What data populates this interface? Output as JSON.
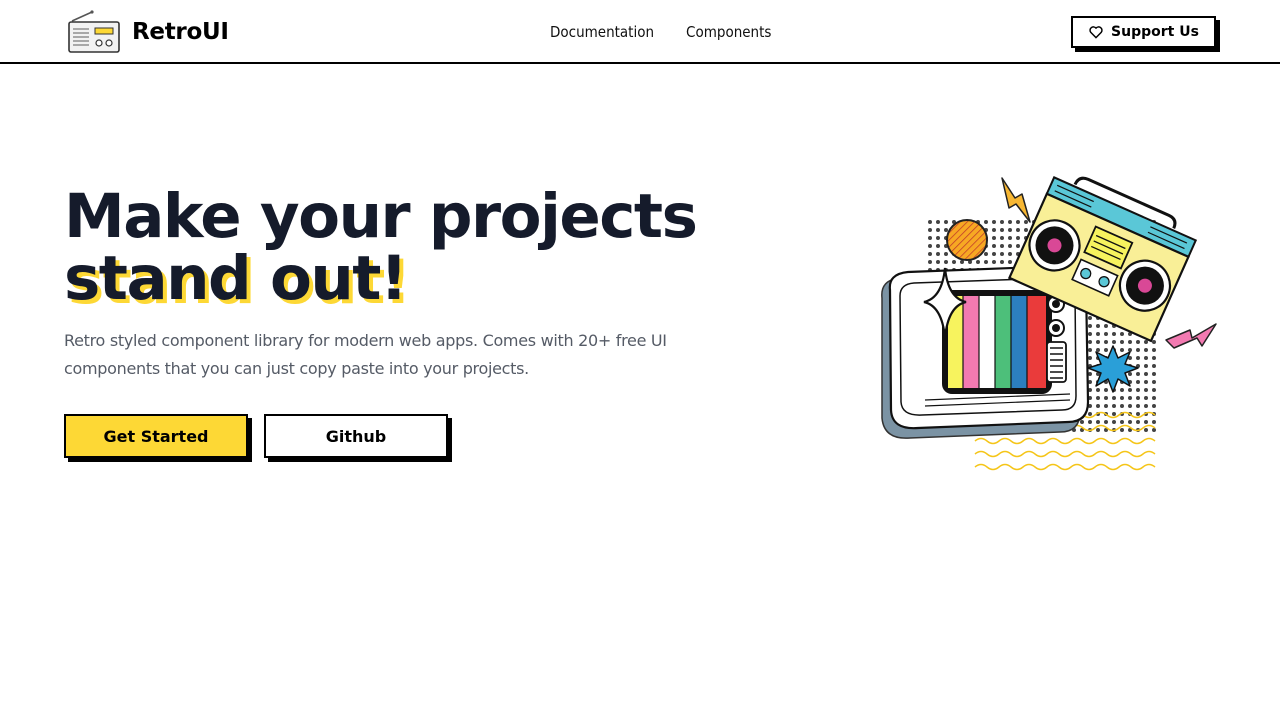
{
  "navbar": {
    "brand_name": "RetroUI",
    "links": [
      {
        "label": "Documentation"
      },
      {
        "label": "Components"
      }
    ],
    "support_label": "Support Us",
    "support_icon": "heart-icon"
  },
  "hero": {
    "title_line1": "Make your projects",
    "title_line2": "stand out!",
    "description": "Retro styled component library for modern web apps. Comes with 20+ free UI components that you can just copy paste into your projects.",
    "primary_button": "Get Started",
    "secondary_button": "Github",
    "illustration": "retro-tv-and-boombox-illustration"
  },
  "colors": {
    "accent_yellow": "#fdd835",
    "title_text": "#151b2b",
    "body_text": "#555b66",
    "border": "#000000"
  }
}
